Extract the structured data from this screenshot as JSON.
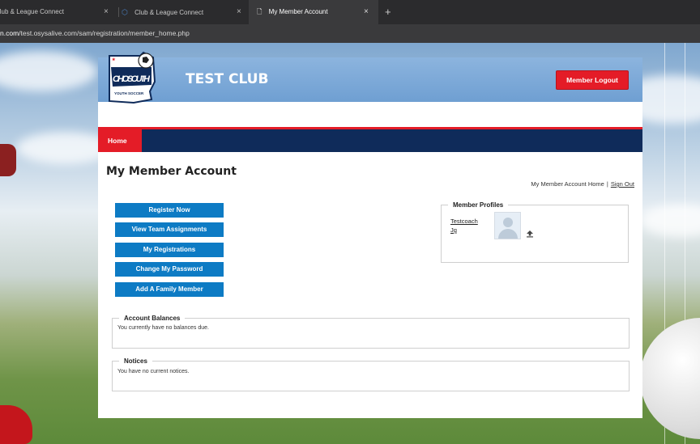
{
  "browser": {
    "tabs": [
      {
        "label": "Club & League Connect"
      },
      {
        "label": "Club & League Connect"
      },
      {
        "label": "My Member Account"
      }
    ],
    "address": {
      "domain": "n.com",
      "path": "/test.osysalive.com/sam/registration/member_home.php"
    }
  },
  "header": {
    "logo_text": "OHIO SOUTH",
    "logo_subtext": "YOUTH SOCCER",
    "club_name": "TEST CLUB",
    "logout_label": "Member Logout"
  },
  "nav": {
    "items": [
      {
        "label": "Home"
      }
    ]
  },
  "main": {
    "heading": "My Member Account",
    "top_links": {
      "home": "My Member Account Home",
      "separator": "|",
      "signout": "Sign Out"
    },
    "actions": [
      {
        "label": "Register Now"
      },
      {
        "label": "View Team Assignments"
      },
      {
        "label": "My Registrations"
      },
      {
        "label": "Change My Password"
      },
      {
        "label": "Add A Family Member"
      }
    ],
    "member_profiles": {
      "legend": "Member Profiles",
      "profiles": [
        {
          "name": "Testcoach Jg"
        }
      ]
    },
    "account_balances": {
      "legend": "Account Balances",
      "text": "You currently have no balances due."
    },
    "notices": {
      "legend": "Notices",
      "text": "You have no current notices."
    }
  },
  "colors": {
    "nav_blue": "#0f2b5a",
    "accent_red": "#e41c27",
    "button_blue": "#0d7bc4",
    "banner_blue": "#6f9fd2"
  }
}
